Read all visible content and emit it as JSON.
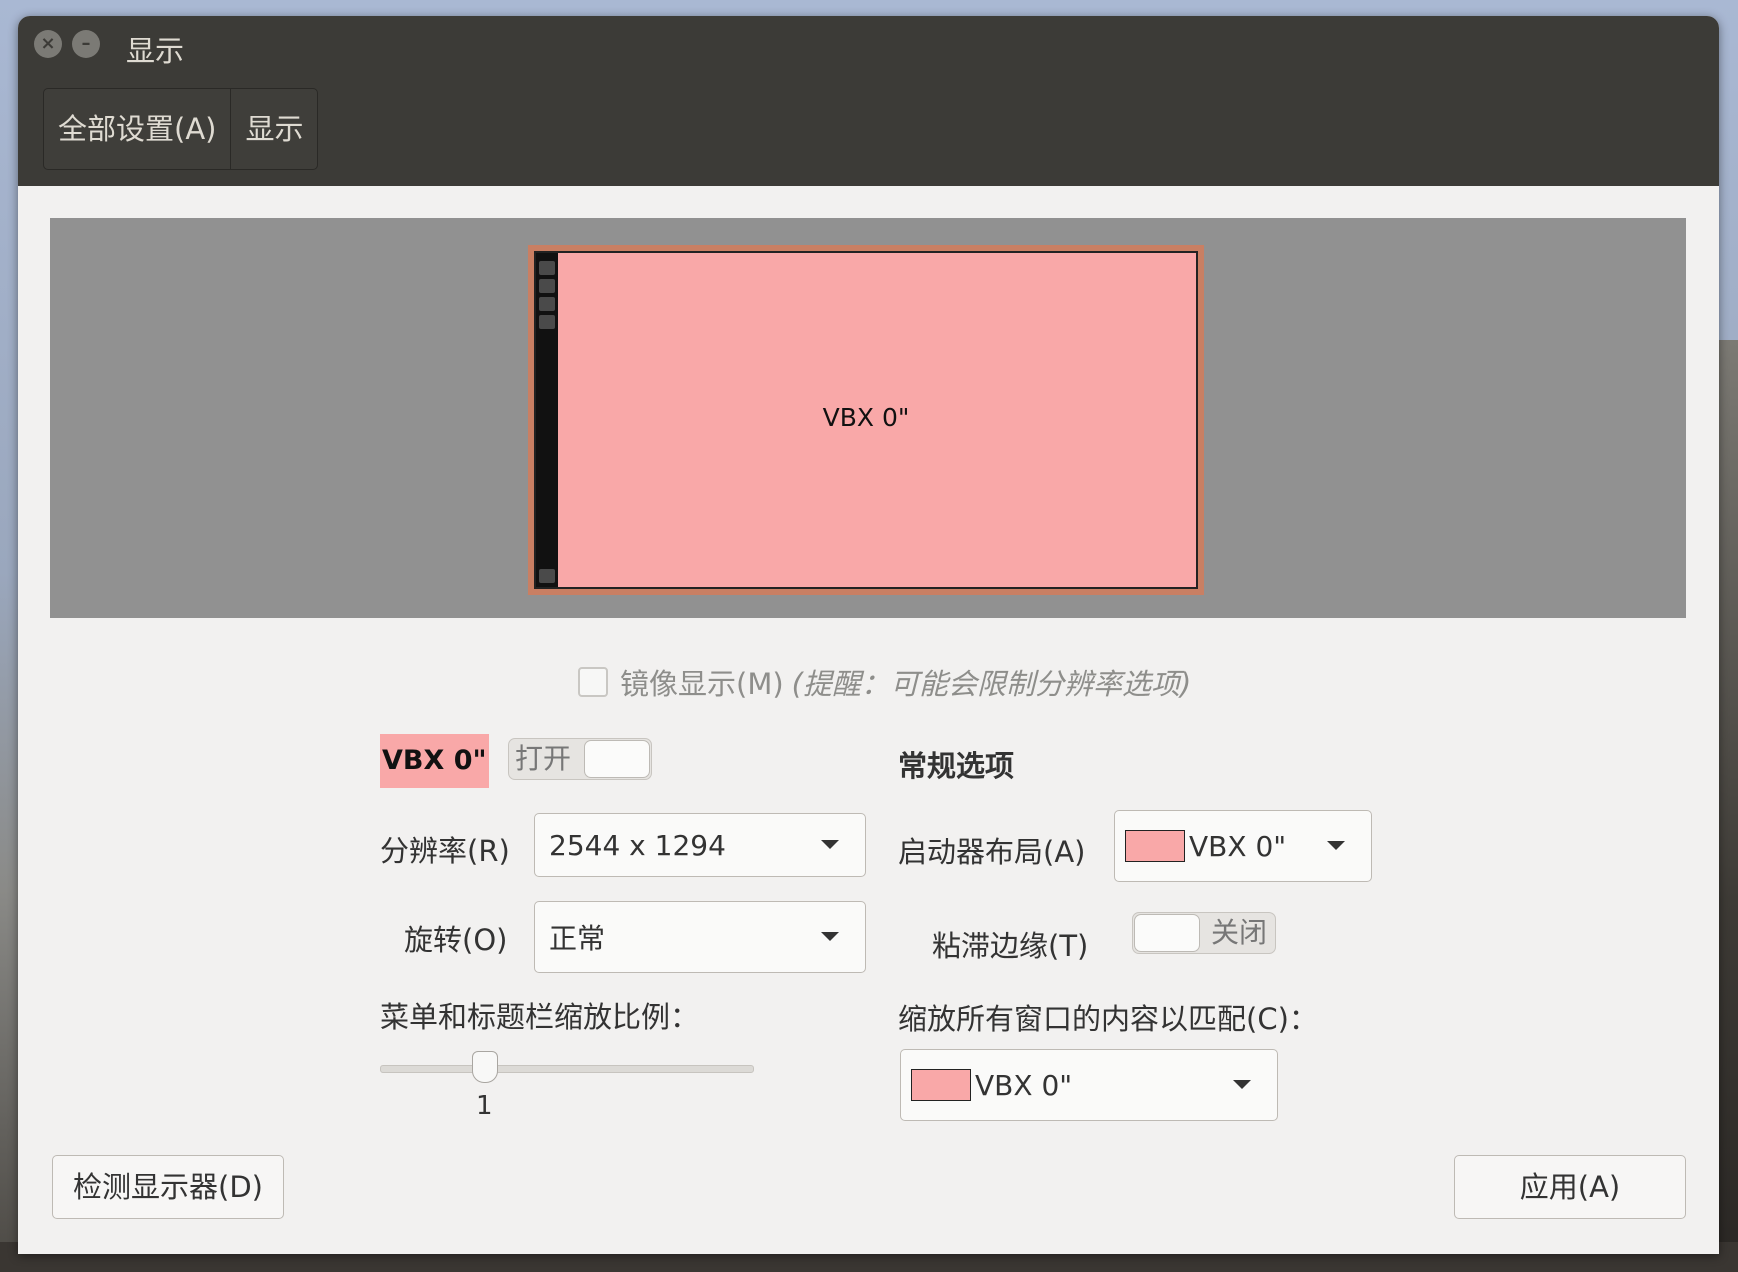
{
  "window": {
    "title": "显示",
    "close_glyph": "×",
    "minimize_glyph": "–"
  },
  "breadcrumb": {
    "all_settings": "全部设置(A)",
    "current": "显示"
  },
  "preview": {
    "monitor_label": "VBX 0\""
  },
  "mirror": {
    "label": "镜像显示(M)",
    "note": "(提醒：可能会限制分辨率选项)",
    "checked": false
  },
  "display": {
    "name": "VBX 0\"",
    "toggle_label": "打开",
    "enabled": true
  },
  "resolution": {
    "label": "分辨率(R)",
    "value": "2544 x 1294"
  },
  "rotation": {
    "label": "旋转(O)",
    "value": "正常"
  },
  "scale": {
    "label": "菜单和标题栏缩放比例：",
    "value": "1"
  },
  "general": {
    "heading": "常规选项",
    "launcher_label": "启动器布局(A)",
    "launcher_value": "VBX 0\"",
    "sticky_label": "粘滞边缘(T)",
    "sticky_toggle_label": "关闭",
    "sticky_enabled": false,
    "scale_all_label": "缩放所有窗口的内容以匹配(C)：",
    "scale_all_value": "VBX 0\""
  },
  "buttons": {
    "detect": "检测显示器(D)",
    "apply": "应用(A)"
  },
  "colors": {
    "monitor_fill": "#f9a8a8",
    "monitor_border": "#c97f63",
    "titlebar": "#3c3b37"
  }
}
